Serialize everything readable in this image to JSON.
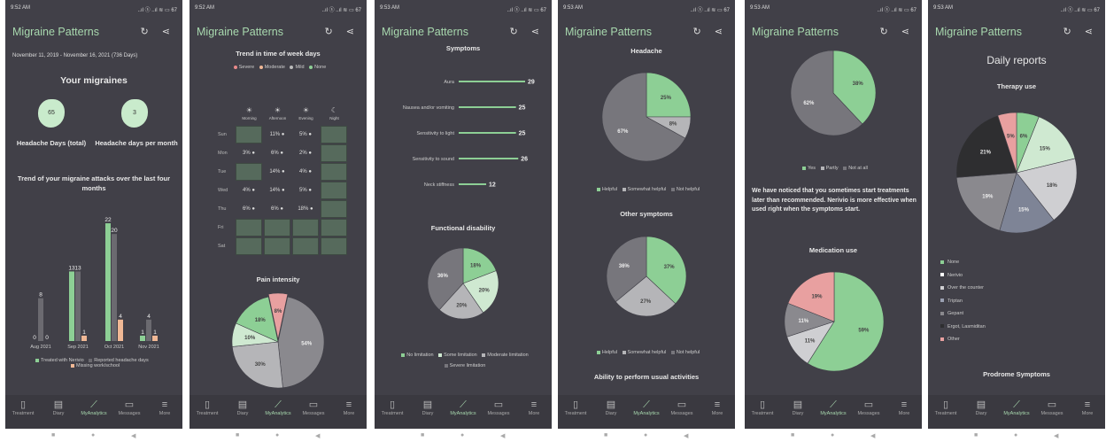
{
  "common": {
    "app_title": "Migraine Patterns",
    "header_icons": "↻ ⋖",
    "status_right": "..ıl ⓢ ..ıl ≋ ▭ 67",
    "nav": {
      "treatment": "Treatment",
      "diary": "Diary",
      "analytics": "MyAnalytics",
      "messages": "Messages",
      "more": "More"
    },
    "nav_icons": {
      "treatment": "▯",
      "diary": "▤",
      "analytics": "⟋",
      "messages": "▭",
      "more": "≡"
    },
    "system_nav": {
      "recents": "■",
      "home": "●",
      "back": "◀"
    }
  },
  "screens": [
    {
      "time": "9:52 AM",
      "date_range": "November 11, 2019 - November 16, 2021 (736 Days)",
      "heading": "Your migraines",
      "stat1": {
        "value": "65",
        "label": "Headache Days (total)"
      },
      "stat2": {
        "value": "3",
        "label": "Headache days per month"
      },
      "trend_title": "Trend of your migraine attacks over the last four months",
      "chart_data": {
        "type": "bar",
        "categories": [
          "Aug 2021",
          "Sep 2021",
          "Oct 2021",
          "Nov 2021"
        ],
        "series": [
          {
            "name": "Treated with Nerivio",
            "values": [
              0,
              13,
              22,
              1
            ],
            "color": "#8dcf95"
          },
          {
            "name": "Reported headache days",
            "values": [
              8,
              13,
              20,
              4
            ],
            "color": "#6b6a70"
          },
          {
            "name": "Missing work/school",
            "values": [
              0,
              1,
              4,
              1
            ],
            "color": "#f0b895"
          }
        ],
        "ylim": [
          0,
          24
        ]
      }
    },
    {
      "time": "9:52 AM",
      "title": "Trend in time of week days",
      "legend": [
        "Severe",
        "Moderate",
        "Mild",
        "None"
      ],
      "legend_colors": [
        "#e88a8a",
        "#f0b895",
        "#bbbbbb",
        "#8dcf95"
      ],
      "columns": [
        "Morning",
        "Afternoon",
        "Evening",
        "Night"
      ],
      "column_icons": [
        "☀",
        "☀",
        "☀",
        "☾"
      ],
      "rows": [
        {
          "day": "Sun",
          "cells": [
            "",
            "11%",
            "5%",
            ""
          ]
        },
        {
          "day": "Mon",
          "cells": [
            "3%",
            "6%",
            "2%",
            ""
          ]
        },
        {
          "day": "Tue",
          "cells": [
            "",
            "14%",
            "4%",
            ""
          ]
        },
        {
          "day": "Wed",
          "cells": [
            "4%",
            "14%",
            "5%",
            ""
          ]
        },
        {
          "day": "Thu",
          "cells": [
            "6%",
            "6%",
            "18%",
            ""
          ]
        },
        {
          "day": "Fri",
          "cells": [
            "",
            "",
            "",
            ""
          ]
        },
        {
          "day": "Sat",
          "cells": [
            "",
            "",
            "",
            ""
          ]
        }
      ],
      "pain_title": "Pain intensity",
      "chart_data": {
        "type": "pie",
        "labels": [
          "Severe",
          "Moderate",
          "Mild",
          "None"
        ],
        "values": [
          8,
          54,
          30,
          10,
          18
        ],
        "slices": [
          {
            "label": "8%",
            "value": 8,
            "color": "#e8a0a0"
          },
          {
            "label": "54%",
            "value": 54,
            "color": "#8a898e"
          },
          {
            "label": "30%",
            "value": 30,
            "color": "#b5b5b8"
          },
          {
            "label": "10%",
            "value": 10,
            "color": "#cfe9d1"
          },
          {
            "label": "18%",
            "value": 18,
            "color": "#8dcf95"
          }
        ]
      }
    },
    {
      "time": "9:53 AM",
      "symptoms_title": "Symptoms",
      "chart_data": {
        "type": "bar",
        "categories": [
          "Aura",
          "Nausea and/or vomiting",
          "Sensitivity to light",
          "Sensitivity to sound",
          "Neck stiffness"
        ],
        "values": [
          29,
          25,
          25,
          26,
          12
        ],
        "xlim": [
          0,
          29
        ]
      },
      "func_title": "Functional disability",
      "func_pie": {
        "type": "pie",
        "slices": [
          {
            "label": "18%",
            "value": 18,
            "color": "#8dcf95"
          },
          {
            "label": "20%",
            "value": 20,
            "color": "#cfe9d1"
          },
          {
            "label": "20%",
            "value": 20,
            "color": "#b5b5b8"
          },
          {
            "label": "36%",
            "value": 36,
            "color": "#77767c"
          }
        ]
      },
      "func_legend": [
        "No limitation",
        "Some limitation",
        "Moderate limitation",
        "Severe limitation"
      ],
      "func_legend_colors": [
        "#8dcf95",
        "#cfe9d1",
        "#b5b5b8",
        "#77767c"
      ]
    },
    {
      "time": "9:53 AM",
      "headache_title": "Headache",
      "headache_pie": {
        "type": "pie",
        "slices": [
          {
            "label": "25%",
            "value": 25,
            "color": "#8dcf95"
          },
          {
            "label": "8%",
            "value": 8,
            "color": "#b5b5b8"
          },
          {
            "label": "67%",
            "value": 67,
            "color": "#77767c"
          }
        ]
      },
      "legend": [
        "Helpful",
        "Somewhat helpful",
        "Not helpful"
      ],
      "legend_colors": [
        "#8dcf95",
        "#b5b5b8",
        "#77767c"
      ],
      "other_title": "Other symptoms",
      "other_pie": {
        "type": "pie",
        "slices": [
          {
            "label": "37%",
            "value": 37,
            "color": "#8dcf95"
          },
          {
            "label": "27%",
            "value": 27,
            "color": "#b5b5b8"
          },
          {
            "label": "36%",
            "value": 36,
            "color": "#77767c"
          }
        ]
      },
      "ability_title": "Ability to perform usual activities"
    },
    {
      "time": "9:53 AM",
      "timing_pie": {
        "type": "pie",
        "slices": [
          {
            "label": "38%",
            "value": 38,
            "color": "#8dcf95"
          },
          {
            "label": "62%",
            "value": 62,
            "color": "#77767c"
          }
        ]
      },
      "legend": [
        "Yes",
        "Partly",
        "Not at all"
      ],
      "legend_colors": [
        "#8dcf95",
        "#b5b5b8",
        "#77767c"
      ],
      "notice": "We have noticed that you sometimes start treatments later than recommended. Nerivio is more effective when used right when the symptoms start.",
      "med_title": "Medication use",
      "med_pie": {
        "type": "pie",
        "slices": [
          {
            "label": "59%",
            "value": 59,
            "color": "#8dcf95"
          },
          {
            "label": "11%",
            "value": 11,
            "color": "#cfcfd2"
          },
          {
            "label": "11%",
            "value": 11,
            "color": "#8a898e"
          },
          {
            "label": "19%",
            "value": 19,
            "color": "#e8a0a0"
          }
        ]
      }
    },
    {
      "time": "9:53 AM",
      "daily_title": "Daily reports",
      "therapy_title": "Therapy use",
      "chart_data": {
        "type": "pie",
        "slices": [
          {
            "label": "6%",
            "value": 6,
            "color": "#8dcf95"
          },
          {
            "label": "15%",
            "value": 15,
            "color": "#cfe9d1"
          },
          {
            "label": "18%",
            "value": 18,
            "color": "#cfcfd2"
          },
          {
            "label": "15%",
            "value": 15,
            "color": "#7e8496"
          },
          {
            "label": "19%",
            "value": 19,
            "color": "#8a898e"
          },
          {
            "label": "21%",
            "value": 21,
            "color": "#2e2e30"
          },
          {
            "label": "5%",
            "value": 5,
            "color": "#e8a0a0"
          }
        ]
      },
      "legend": [
        "None",
        "Nerivio",
        "Over the counter",
        "Triptan",
        "Gepant",
        "Ergot, Lasmiditan",
        "Other"
      ],
      "legend_colors": [
        "#8dcf95",
        "#ffffff",
        "#cfcfd2",
        "#9aa0b2",
        "#8a898e",
        "#2e2e30",
        "#e8a0a0"
      ],
      "prodrome_title": "Prodrome Symptoms"
    }
  ]
}
